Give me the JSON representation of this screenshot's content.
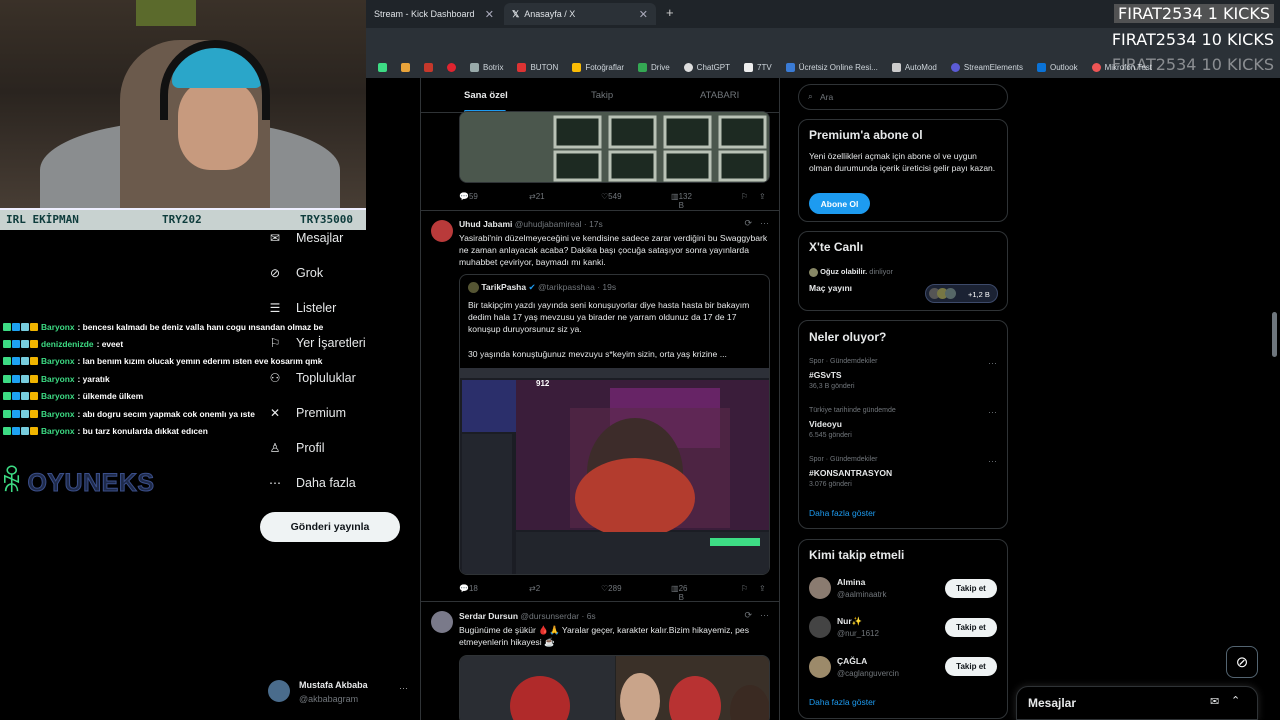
{
  "browser": {
    "tabs": [
      {
        "title": "Stream - Kick Dashboard",
        "active": false
      },
      {
        "title": "Anasayfa / X",
        "active": true
      }
    ],
    "bookmarks": [
      "Botrix",
      "BUTON",
      "Fotoğraflar",
      "Drive",
      "ChatGPT",
      "7TV",
      "Ücretsiz Online Resi...",
      "AutoMod",
      "StreamElements",
      "Outlook",
      "Mikrofon Test"
    ]
  },
  "stream_overlay": {
    "alerts": [
      "FIRAT2534 1 KICKS",
      "FIRAT2534 10 KICKS",
      "FIRAT2534 10 KICKS"
    ],
    "bar": [
      "IRL EKİPMAN",
      "TRY202",
      "TRY35000"
    ],
    "logo_text": "OYUNEKS",
    "chat": [
      {
        "user": "Baryonx",
        "msg": ": bencesı kalmadı be deniz valla hanı cogu ınsandan olmaz be",
        "color": "#3ddc84"
      },
      {
        "user": "denizdenizde",
        "msg": ": eveet",
        "color": "#3ddc84"
      },
      {
        "user": "Baryonx",
        "msg": ": lan benım kızım olucak yemın ederım ısten eve kosarım qmk",
        "color": "#3ddc84"
      },
      {
        "user": "Baryonx",
        "msg": ": yaratık",
        "color": "#3ddc84"
      },
      {
        "user": "Baryonx",
        "msg": ": ülkemde ülkem",
        "color": "#3ddc84"
      },
      {
        "user": "Baryonx",
        "msg": ": abı dogru secım yapmak cok onemlı ya ıste",
        "color": "#3ddc84"
      },
      {
        "user": "Baryonx",
        "msg": ": bu tarz konularda dıkkat edıcen",
        "color": "#3ddc84"
      }
    ]
  },
  "nav": {
    "items": [
      "Mesajlar",
      "Grok",
      "Listeler",
      "Yer İşaretleri",
      "Topluluklar",
      "Premium",
      "Profil",
      "Daha fazla"
    ],
    "post_button": "Gönderi yayınla",
    "account": {
      "name": "Mustafa Akbaba",
      "handle": "@akbabagram"
    }
  },
  "timeline": {
    "tabs": [
      "Sana özel",
      "Takip",
      "ATABARI"
    ],
    "tweets": [
      {
        "stats": [
          "59",
          "21",
          "549",
          "132 B"
        ]
      },
      {
        "name": "Uhud Jabami",
        "handle": "@uhudjabamireal",
        "time": "· 17s",
        "text": "Yasirabi'nin düzelmeyeceğini ve kendisine sadece zarar verdiğini bu Swaggybark ne zaman anlayacak acaba? Dakika başı çocuğa sataşıyor sonra yayınlarda muhabbet çeviriyor, baymadı mı kanki.",
        "quote": {
          "name": "TarikPasha",
          "handle": "@tarikpasshaa",
          "time": "· 19s",
          "text1": "Bir takipçim yazdı yayında seni konuşuyorlar diye hasta hasta bir bakayım dedim hala 17 yaş mevzusu ya birader ne yarram oldunuz da 17 de 17 konuşup duruyorsunuz siz ya.",
          "text2": "30 yaşında konuştuğunuz mevzuyu s*keyim sizin, orta yaş krizine ...",
          "viewer_count": "912"
        },
        "stats": [
          "18",
          "2",
          "289",
          "26 B"
        ]
      },
      {
        "name": "Serdar Dursun",
        "handle": "@dursunserdar",
        "time": "· 6s",
        "text": "Bugünüme de şükür 🩸🙏 Yaralar geçer, karakter kalır.Bizim hikayemiz, pes etmeyenlerin hikayesi ☕"
      }
    ]
  },
  "sidebar": {
    "search_placeholder": "Ara",
    "premium": {
      "title": "Premium'a abone ol",
      "text": "Yeni özellikleri açmak için abone ol ve uygun olman durumunda içerik üreticisi gelir payı kazan.",
      "button": "Abone Ol"
    },
    "live": {
      "title": "X'te Canlı",
      "host": "Oğuz olabilir.",
      "host_suffix": "dinliyor",
      "stream": "Maç yayını",
      "listeners": "+1,2 B"
    },
    "trends": {
      "title": "Neler oluyor?",
      "items": [
        {
          "category": "Spor · Gündemdekiler",
          "name": "#GSvTS",
          "count": "36,3 B gönderi"
        },
        {
          "category": "Türkiye tarihinde gündemde",
          "name": "Videoyu",
          "count": "6.545 gönderi"
        },
        {
          "category": "Spor · Gündemdekiler",
          "name": "#KONSANTRASYON",
          "count": "3.076 gönderi"
        }
      ],
      "more": "Daha fazla göster"
    },
    "who_to_follow": {
      "title": "Kimi takip etmeli",
      "items": [
        {
          "name": "Almina",
          "handle": "@aalminaatrk",
          "button": "Takip et"
        },
        {
          "name": "Nur✨",
          "handle": "@nur_1612",
          "button": "Takip et"
        },
        {
          "name": "ÇAĞLA",
          "handle": "@caglanguvercin",
          "button": "Takip et"
        }
      ],
      "more": "Daha fazla göster"
    },
    "messages": "Mesajlar"
  },
  "colors": {
    "accent": "#1d9bf0",
    "kick_green": "#3ddc84",
    "bg": "#000000",
    "border": "#2f3336"
  }
}
